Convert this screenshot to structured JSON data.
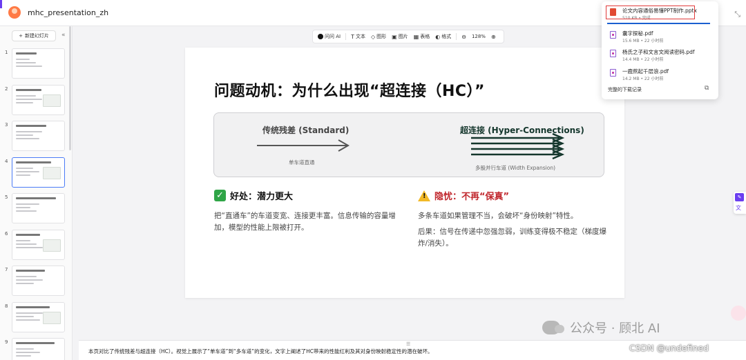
{
  "app": {
    "title": "mhc_presentation_zh"
  },
  "sidebar": {
    "new_slide_label": "新建幻灯片",
    "slides": [
      {
        "num": "1"
      },
      {
        "num": "2"
      },
      {
        "num": "3"
      },
      {
        "num": "4"
      },
      {
        "num": "5"
      },
      {
        "num": "6"
      },
      {
        "num": "7"
      },
      {
        "num": "8"
      },
      {
        "num": "9"
      }
    ],
    "active_index": 3
  },
  "toolbar": {
    "ai": "问问 AI",
    "text": "文本",
    "shape": "图形",
    "image": "图片",
    "table": "表格",
    "format": "格式",
    "zoom": "128%"
  },
  "slide": {
    "title": "问题动机：为什么出现“超连接（HC）”",
    "left_title": "传统残差 (Standard)",
    "left_caption": "单车道直通",
    "right_title": "超连接 (Hyper-Connections)",
    "right_caption": "多股并行车道 (Width Expansion)",
    "good_title": "好处：潜力更大",
    "good_body": "把“直通车”的车道变宽、连接更丰富。信息传输的容量增加，模型的性能上限被打开。",
    "warn_title": "隐忧：不再“保真”",
    "warn_body_1": "多条车道如果管理不当，会破坏“身份映射”特性。",
    "warn_body_2": "后果：信号在传递中忽强忽弱，训练变得极不稳定（梯度爆炸/消失）。",
    "colors": {
      "good": "#2fa547",
      "warn": "#c0262c",
      "arrow_right": "#14362c"
    }
  },
  "downloads": {
    "items": [
      {
        "name": "论文内容通俗易懂PPT制作.pptx",
        "meta": "510 KB • 完成",
        "type": "ppt"
      },
      {
        "name": "囊字探秘.pdf",
        "meta": "15.6 MB • 22 小时前",
        "type": "pdf"
      },
      {
        "name": "杨氏之子和文言文阅读密码.pdf",
        "meta": "14.4 MB • 22 小时前",
        "type": "pdf"
      },
      {
        "name": "一鹿熬起千层浪.pdf",
        "meta": "14.2 MB • 22 小时前",
        "type": "pdf"
      }
    ],
    "footer": "完整的下载记录"
  },
  "notes": {
    "text": "本页对比了传统残差与超连接（HC）。视觉上展示了“单车道”到“多车道”的变化，文字上阐述了HC带来的性能红利及其对身份映射稳定性的潜在破坏。"
  },
  "watermark": {
    "brand": "公众号 · 顾北 AI",
    "csdn": "CSDN @undefined"
  }
}
